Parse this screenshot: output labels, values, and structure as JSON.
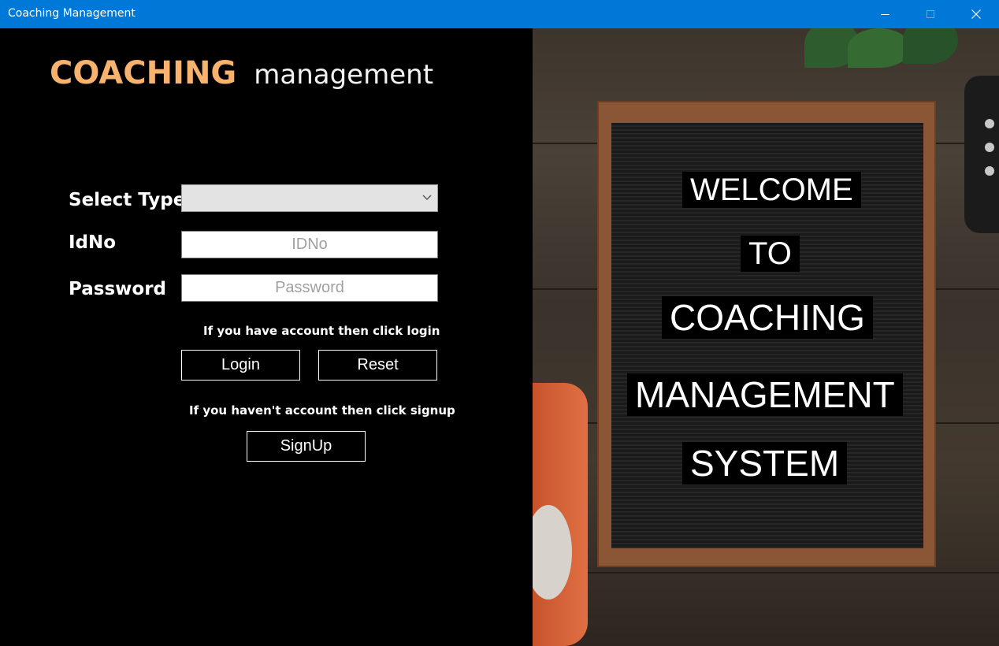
{
  "window": {
    "title": "Coaching Management"
  },
  "brand": {
    "part1": "COACHING",
    "part2": "management",
    "color_primary": "#f7b26d"
  },
  "form": {
    "select_type_label": "Select Type",
    "select_type_value": "",
    "idno_label": "IdNo",
    "idno_placeholder": "IDNo",
    "password_label": "Password",
    "password_placeholder": "Password",
    "login_hint": "If you have account then click login",
    "login_button": "Login",
    "reset_button": "Reset",
    "signup_hint": "If you haven't account then click signup",
    "signup_button": "SignUp"
  },
  "board": {
    "lines": [
      "WELCOME",
      "TO",
      "COACHING",
      "MANAGEMENT",
      "SYSTEM"
    ]
  },
  "icons": {
    "minimize": "minimize-icon",
    "maximize": "maximize-icon",
    "close": "close-icon",
    "dropdown": "chevron-down-icon"
  },
  "colors": {
    "titlebar": "#0078d7",
    "background": "#000000"
  }
}
